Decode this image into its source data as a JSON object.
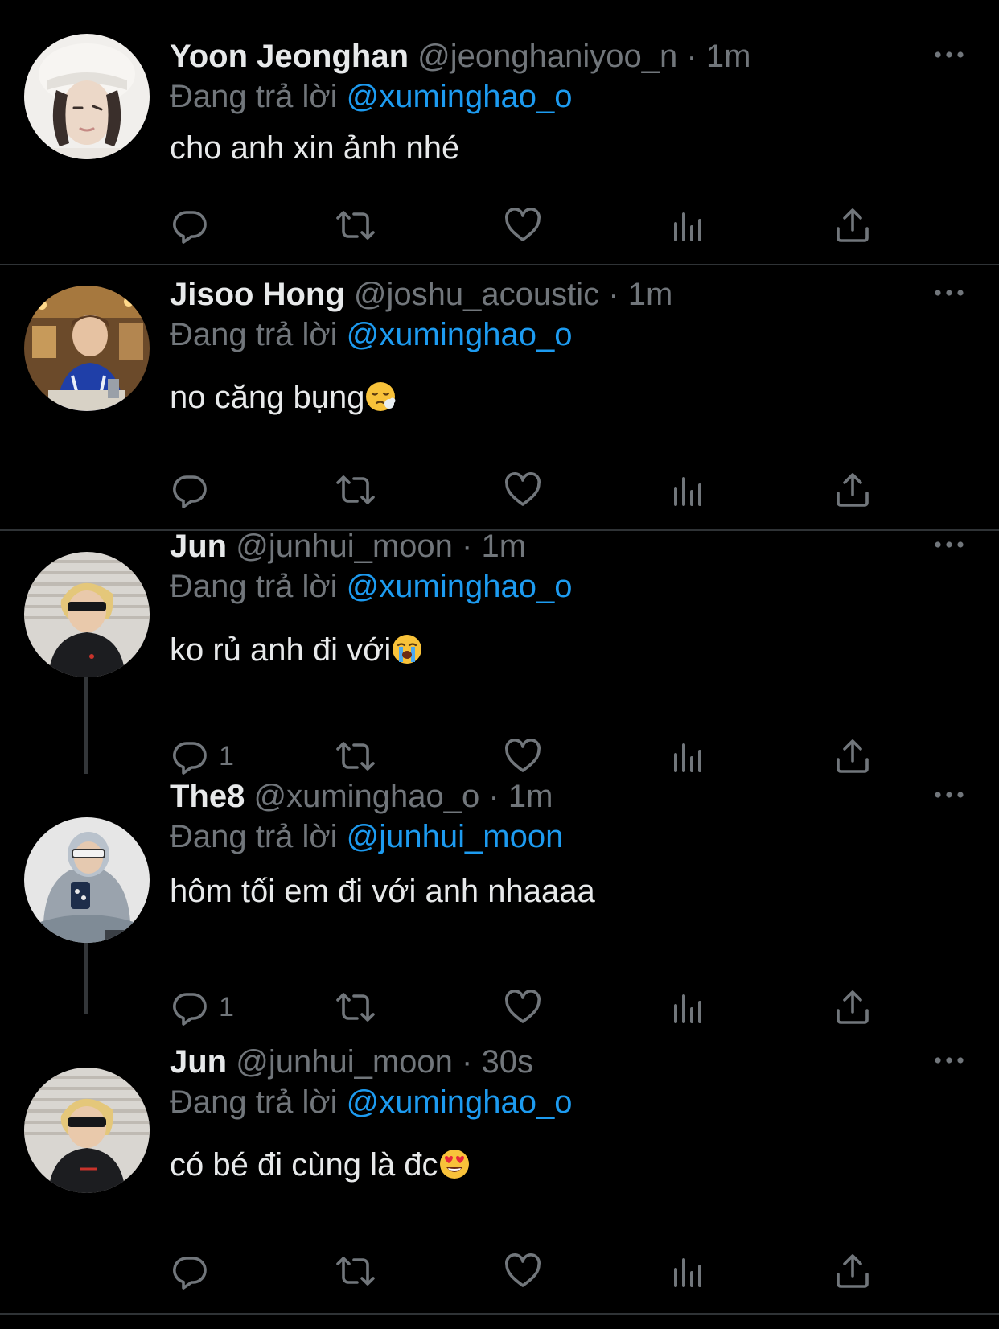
{
  "reply_prefix": "Đang trả lời",
  "tweets": [
    {
      "name": "Yoon Jeonghan",
      "handle": "@jeonghaniyoo_n",
      "time": "1m",
      "replying_to": "@xuminghao_o",
      "text": "cho anh xin ảnh nhé",
      "reply_count": ""
    },
    {
      "name": "Jisoo Hong",
      "handle": "@joshu_acoustic",
      "time": "1m",
      "replying_to": "@xuminghao_o",
      "text": "no căng bụng",
      "reply_count": ""
    },
    {
      "name": "Jun",
      "handle": "@junhui_moon",
      "time": "1m",
      "replying_to": "@xuminghao_o",
      "text": "ko rủ anh đi với",
      "reply_count": "1"
    },
    {
      "name": "The8",
      "handle": "@xuminghao_o",
      "time": "1m",
      "replying_to": "@junhui_moon",
      "text": "hôm tối em đi với anh nhaaaa",
      "reply_count": "1"
    },
    {
      "name": "Jun",
      "handle": "@junhui_moon",
      "time": "30s",
      "replying_to": "@xuminghao_o",
      "text": "có bé đi cùng là đc",
      "reply_count": ""
    }
  ],
  "colors": {
    "background": "#000000",
    "primary_text": "#e7e9ea",
    "secondary_text": "#71767b",
    "accent": "#1d9bf0",
    "divider": "#2f3336"
  },
  "icons": [
    "reply-icon",
    "retweet-icon",
    "like-icon",
    "views-icon",
    "share-icon",
    "more-icon"
  ]
}
